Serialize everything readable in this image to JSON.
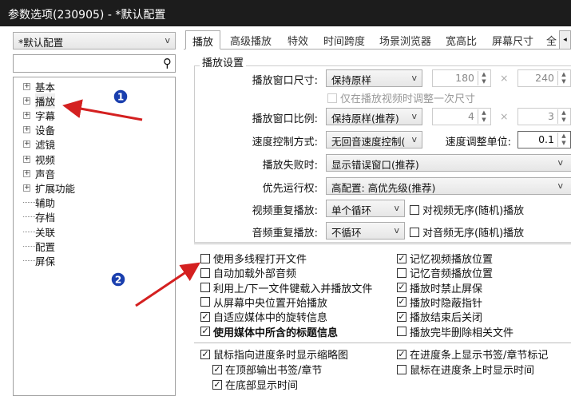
{
  "window": {
    "title": "参数选项(230905) - *默认配置"
  },
  "sidebar": {
    "profile": "*默认配置",
    "search_placeholder": "",
    "tree": [
      {
        "label": "基本",
        "expandable": true
      },
      {
        "label": "播放",
        "expandable": true
      },
      {
        "label": "字幕",
        "expandable": true
      },
      {
        "label": "设备",
        "expandable": true
      },
      {
        "label": "滤镜",
        "expandable": true
      },
      {
        "label": "视频",
        "expandable": true
      },
      {
        "label": "声音",
        "expandable": true
      },
      {
        "label": "扩展功能",
        "expandable": true
      },
      {
        "label": "辅助",
        "expandable": false
      },
      {
        "label": "存档",
        "expandable": false
      },
      {
        "label": "关联",
        "expandable": false
      },
      {
        "label": "配置",
        "expandable": false
      },
      {
        "label": "屏保",
        "expandable": false
      }
    ]
  },
  "tabs": [
    "播放",
    "高级播放",
    "特效",
    "时间跨度",
    "场景浏览器",
    "宽高比",
    "屏幕尺寸",
    "全"
  ],
  "group": {
    "title": "播放设置",
    "window_size": {
      "label": "播放窗口尺寸:",
      "value": "保持原样",
      "w": "180",
      "h": "240",
      "times": "×"
    },
    "resize_once": "仅在播放视频时调整一次尺寸",
    "ratio": {
      "label": "播放窗口比例:",
      "value": "保持原样(推荐)",
      "w": "4",
      "h": "3",
      "times": "×"
    },
    "speed": {
      "label": "速度控制方式:",
      "value": "无回音速度控制(",
      "unit_label": "速度调整单位:",
      "unit": "0.1"
    },
    "fail": {
      "label": "播放失败时:",
      "value": "显示错误窗口(推荐)"
    },
    "priority": {
      "label": "优先运行权:",
      "value": "高配置: 高优先级(推荐)"
    },
    "video_repeat": {
      "label": "视频重复播放:",
      "value": "单个循环",
      "shuffle": "对视频无序(随机)播放"
    },
    "audio_repeat": {
      "label": "音频重复播放:",
      "value": "不循环",
      "shuffle": "对音频无序(随机)播放"
    }
  },
  "options_left": [
    {
      "label": "使用多线程打开文件",
      "checked": false
    },
    {
      "label": "自动加载外部音频",
      "checked": false
    },
    {
      "label": "利用上/下一文件键载入并播放文件",
      "checked": false
    },
    {
      "label": "从屏幕中央位置开始播放",
      "checked": false
    },
    {
      "label": "自适应媒体中的旋转信息",
      "checked": true
    },
    {
      "label": "使用媒体中所含的标题信息",
      "checked": true
    }
  ],
  "options_right": [
    {
      "label": "记忆视频播放位置",
      "checked": true
    },
    {
      "label": "记忆音频播放位置",
      "checked": false
    },
    {
      "label": "播放时禁止屏保",
      "checked": true
    },
    {
      "label": "播放时隐蔽指针",
      "checked": true
    },
    {
      "label": "播放结束后关闭",
      "checked": true
    },
    {
      "label": "播放完毕删除相关文件",
      "checked": false
    }
  ],
  "seek": {
    "thumb": "鼠标指向进度条时显示缩略图",
    "bookmarks_top": "在顶部输出书签/章节",
    "time_bottom": "在底部显示时间",
    "marks": "在进度条上显示书签/章节标记",
    "hover_time": "鼠标在进度条上时显示时间"
  },
  "annotations": [
    "1",
    "2"
  ],
  "colors": {
    "accent": "#1a3fae",
    "arrow": "#d42020"
  }
}
